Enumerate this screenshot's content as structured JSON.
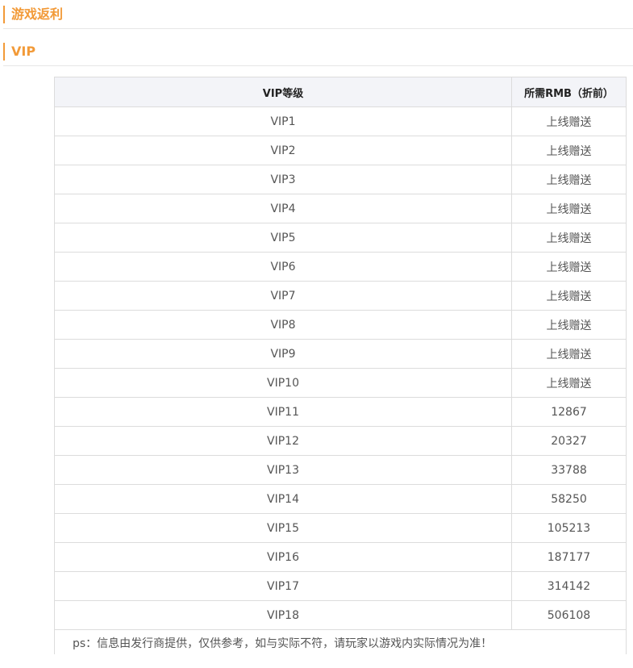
{
  "sections": {
    "rebate_title": "游戏返利",
    "vip_title": "VIP"
  },
  "accent_color": "#f29a38",
  "table": {
    "headers": {
      "level": "VIP等级",
      "rmb": "所需RMB（折前）"
    },
    "rows": [
      {
        "level": "VIP1",
        "rmb": "上线赠送"
      },
      {
        "level": "VIP2",
        "rmb": "上线赠送"
      },
      {
        "level": "VIP3",
        "rmb": "上线赠送"
      },
      {
        "level": "VIP4",
        "rmb": "上线赠送"
      },
      {
        "level": "VIP5",
        "rmb": "上线赠送"
      },
      {
        "level": "VIP6",
        "rmb": "上线赠送"
      },
      {
        "level": "VIP7",
        "rmb": "上线赠送"
      },
      {
        "level": "VIP8",
        "rmb": "上线赠送"
      },
      {
        "level": "VIP9",
        "rmb": "上线赠送"
      },
      {
        "level": "VIP10",
        "rmb": "上线赠送"
      },
      {
        "level": "VIP11",
        "rmb": "12867"
      },
      {
        "level": "VIP12",
        "rmb": "20327"
      },
      {
        "level": "VIP13",
        "rmb": "33788"
      },
      {
        "level": "VIP14",
        "rmb": "58250"
      },
      {
        "level": "VIP15",
        "rmb": "105213"
      },
      {
        "level": "VIP16",
        "rmb": "187177"
      },
      {
        "level": "VIP17",
        "rmb": "314142"
      },
      {
        "level": "VIP18",
        "rmb": "506108"
      }
    ],
    "note": "ps：信息由发行商提供，仅供参考，如与实际不符，请玩家以游戏内实际情况为准！"
  }
}
